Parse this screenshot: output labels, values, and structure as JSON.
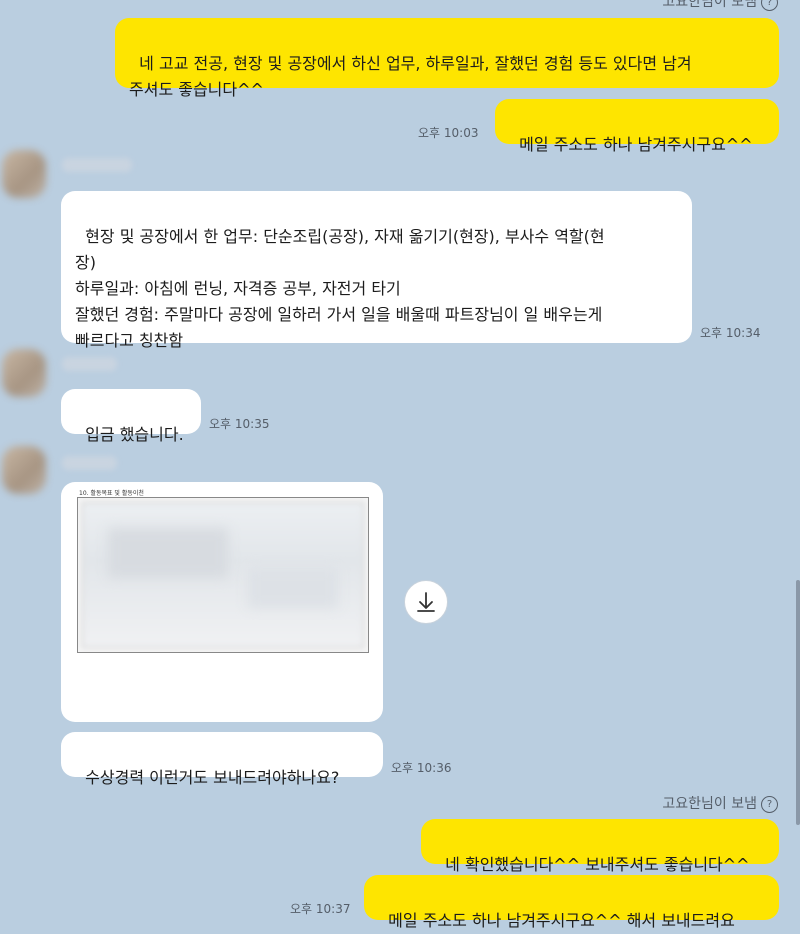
{
  "top_note": {
    "text": "고요한님이 보냄"
  },
  "messages": {
    "m1": {
      "text": "네 고교 전공, 현장 및 공장에서 하신 업무, 하루일과, 잘했던 경험 등도 있다면 남겨\n주셔도 좋습니다^^"
    },
    "m2": {
      "text": "메일 주소도 하나 남겨주시구요^^",
      "time": "오후 10:03"
    },
    "m3": {
      "text": "현장 및 공장에서 한 업무: 단순조립(공장), 자재 옮기기(현장), 부사수 역할(현\n장)\n하루일과: 아침에 런닝, 자격증 공부, 자전거 타기\n잘했던 경험: 주말마다 공장에 일하러 가서 일을 배울때 파트장님이 일 배우는게\n빠르다고 칭찬함",
      "time": "오후 10:34"
    },
    "m4": {
      "text": "입금 했습니다.",
      "time": "오후 10:35"
    },
    "m5": {
      "doc_title": "10. 활동목표 및 활동이천",
      "download_icon": "download-icon"
    },
    "m6": {
      "text": "수상경력 이런거도 보내드려야하나요?",
      "time": "오후 10:36"
    },
    "note2": {
      "text": "고요한님이 보냄"
    },
    "m7": {
      "text": "네 확인했습니다^^ 보내주셔도 좋습니다^^"
    },
    "m8": {
      "text": "메일 주소도 하나 남겨주시구요^^ 해서 보내드려요",
      "time": "오후 10:37"
    }
  },
  "colors": {
    "background": "#bacee0",
    "my_bubble": "#fee500",
    "their_bubble": "#ffffff"
  }
}
